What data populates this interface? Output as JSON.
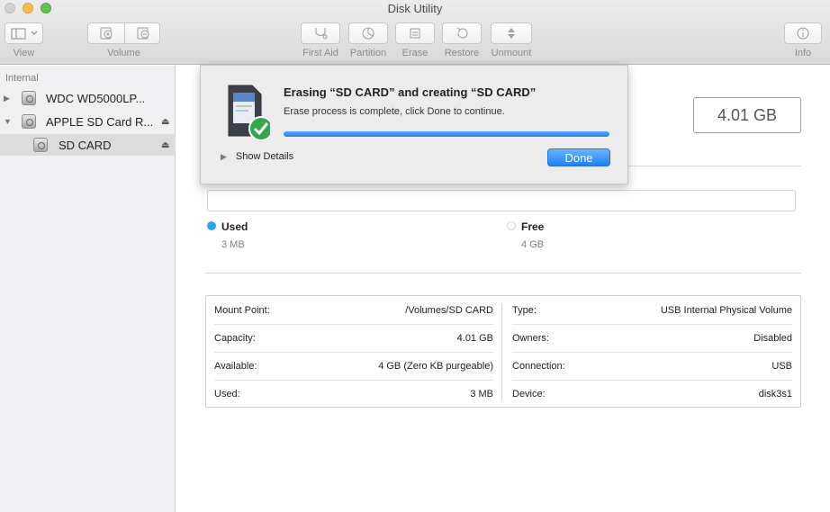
{
  "window": {
    "title": "Disk Utility"
  },
  "toolbar": {
    "view_label": "View",
    "volume_label": "Volume",
    "first_aid_label": "First Aid",
    "partition_label": "Partition",
    "erase_label": "Erase",
    "restore_label": "Restore",
    "unmount_label": "Unmount",
    "info_label": "Info"
  },
  "sidebar": {
    "section": "Internal",
    "items": [
      {
        "label": "WDC WD5000LP...",
        "expanded": false
      },
      {
        "label": "APPLE SD Card R...",
        "expanded": true
      },
      {
        "label": "SD CARD",
        "selected": true
      }
    ]
  },
  "main": {
    "capacity": "4.01 GB",
    "usage": {
      "used_title": "Used",
      "used_value": "3 MB",
      "used_color": "#29a8e8",
      "free_title": "Free",
      "free_value": "4 GB",
      "free_color": "#ffffff"
    },
    "info": {
      "left": [
        {
          "key": "Mount Point:",
          "value": "/Volumes/SD CARD"
        },
        {
          "key": "Capacity:",
          "value": "4.01 GB"
        },
        {
          "key": "Available:",
          "value": "4 GB (Zero KB purgeable)"
        },
        {
          "key": "Used:",
          "value": "3 MB"
        }
      ],
      "right": [
        {
          "key": "Type:",
          "value": "USB Internal Physical Volume"
        },
        {
          "key": "Owners:",
          "value": "Disabled"
        },
        {
          "key": "Connection:",
          "value": "USB"
        },
        {
          "key": "Device:",
          "value": "disk3s1"
        }
      ]
    }
  },
  "dialog": {
    "title": "Erasing “SD CARD” and creating “SD CARD”",
    "message": "Erase process is complete, click Done to continue.",
    "progress": 1.0,
    "show_details_label": "Show Details",
    "done_label": "Done"
  },
  "colors": {
    "accent": "#2c86e6",
    "success": "#2fa84f"
  }
}
